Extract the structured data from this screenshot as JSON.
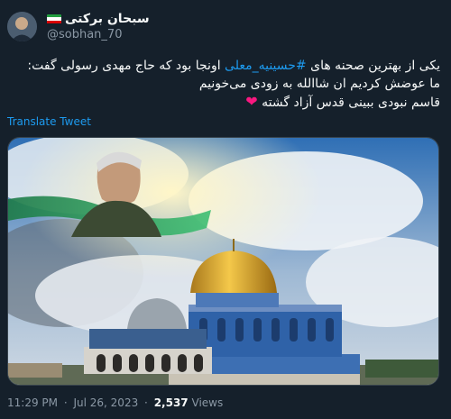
{
  "user": {
    "display_name": "سبحان برکتی",
    "handle": "@sobhan_70",
    "flag_colors": [
      "#239f40",
      "#ffffff",
      "#da0000"
    ]
  },
  "tweet": {
    "line1_before": "یکی از بهترین صحنه های",
    "hashtag": "#حسینیه_معلی",
    "line1_after": "اونجا بود که حاج مهدی رسولی گفت:",
    "line2": "ما عوضش کردیم ان شاالله به زودی می‌خونیم",
    "line3": "قاسم نبودی ببینی قدس آزاد گشته",
    "heart": "❤"
  },
  "translate_label": "Translate Tweet",
  "meta": {
    "time": "11:29 PM",
    "date": "Jul 26, 2023",
    "dot": "·",
    "views_count": "2,537",
    "views_label": "Views"
  },
  "colors": {
    "background": "#15202b",
    "link": "#1d9bf0",
    "muted": "#8b98a5"
  }
}
